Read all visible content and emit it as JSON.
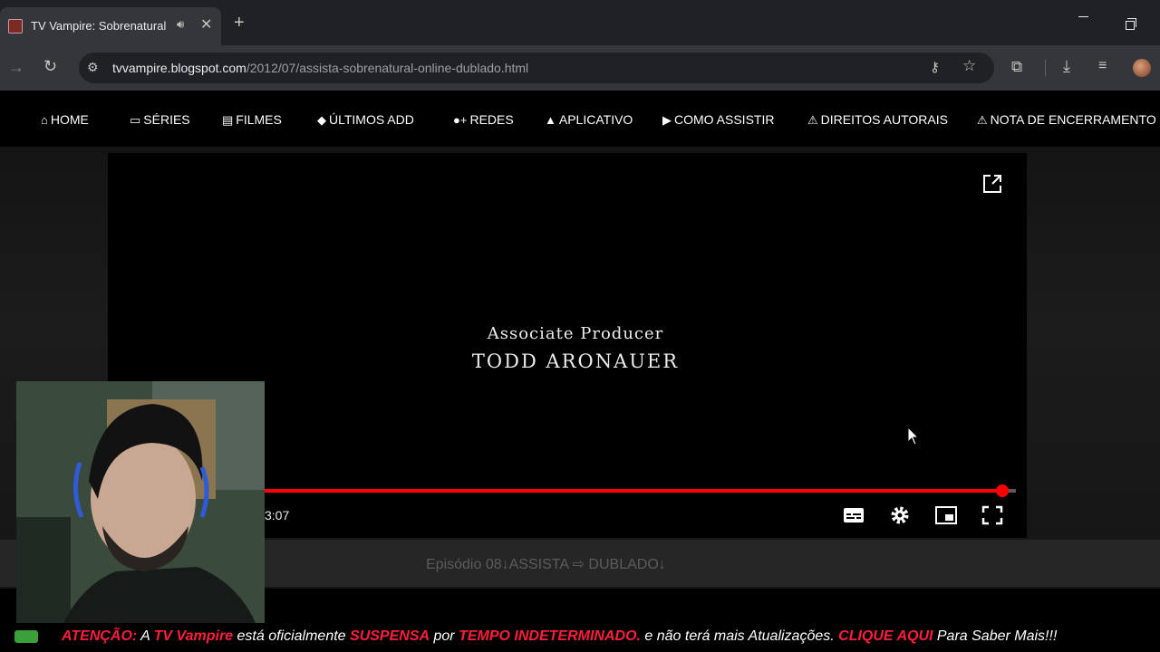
{
  "browser": {
    "tab_title": "TV Vampire: Sobrenatural",
    "url_host": "tvvampire.blogspot.com",
    "url_path": "/2012/07/assista-sobrenatural-online-dublado.html"
  },
  "site_nav": {
    "items": [
      {
        "label": "HOME",
        "icon": "home-icon"
      },
      {
        "label": "SÉRIES",
        "icon": "tv-icon"
      },
      {
        "label": "FILMES",
        "icon": "film-icon"
      },
      {
        "label": "ÚLTIMOS ADD",
        "icon": "tags-icon"
      },
      {
        "label": "REDES",
        "icon": "user-plus-icon"
      },
      {
        "label": "APLICATIVO",
        "icon": "android-icon"
      },
      {
        "label": "COMO ASSISTIR",
        "icon": "youtube-icon"
      },
      {
        "label": "DIREITOS AUTORAIS",
        "icon": "warning-icon"
      },
      {
        "label": "NOTA DE ENCERRAMENTO",
        "icon": "warning-icon"
      }
    ]
  },
  "video": {
    "credit_role": "Associate Producer",
    "credit_name": "TODD ARONAUER",
    "time": "3:07",
    "progress": 0.982,
    "accent_color": "#ff0000"
  },
  "page": {
    "episode_link": "Episódio 08↓ASSISTA ⇨ DUBLADO↓"
  },
  "announcement": {
    "p1": "ATENÇÃO:",
    "p2": " A ",
    "p3": "TV Vampire",
    "p4": " está oficialmente ",
    "p5": "SUSPENSA",
    "p6": " por ",
    "p7": "TEMPO INDETERMINADO.",
    "p8": " e não terá mais Atualizações. ",
    "p9": "CLIQUE AQUI",
    "p10": " Para Saber Mais!!!"
  }
}
